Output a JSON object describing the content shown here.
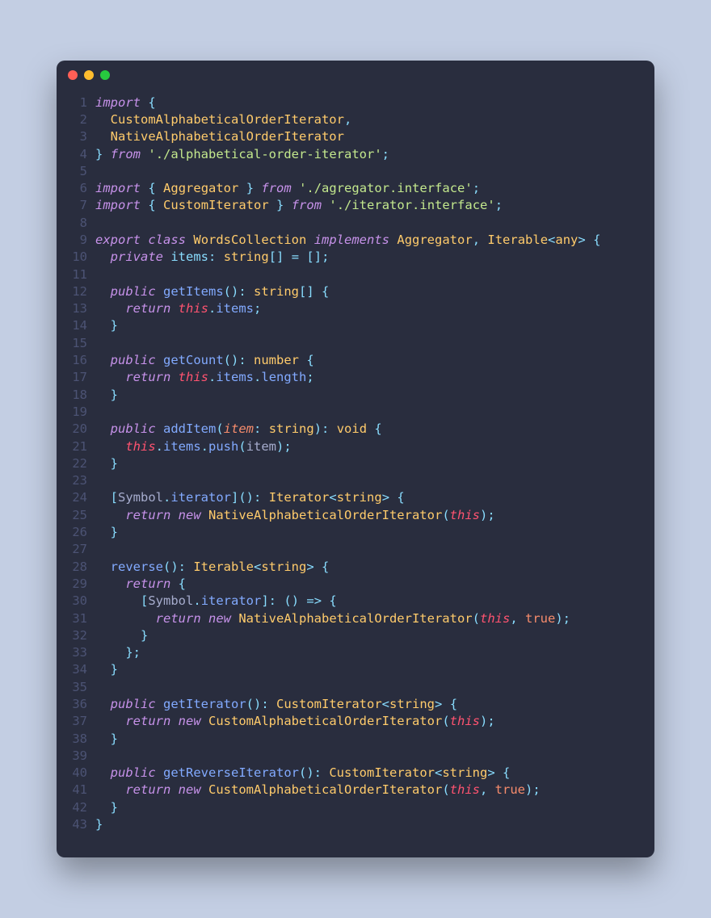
{
  "window": {
    "traffic_lights": [
      "close",
      "minimize",
      "zoom"
    ]
  },
  "code": {
    "language": "typescript",
    "lines": [
      [
        [
          "kw",
          "import"
        ],
        [
          "def",
          " "
        ],
        [
          "pun",
          "{"
        ]
      ],
      [
        [
          "def",
          "  "
        ],
        [
          "cls",
          "CustomAlphabeticalOrderIterator"
        ],
        [
          "pun",
          ","
        ]
      ],
      [
        [
          "def",
          "  "
        ],
        [
          "cls",
          "NativeAlphabeticalOrderIterator"
        ]
      ],
      [
        [
          "pun",
          "}"
        ],
        [
          "def",
          " "
        ],
        [
          "kw",
          "from"
        ],
        [
          "def",
          " "
        ],
        [
          "str",
          "'./alphabetical-order-iterator'"
        ],
        [
          "pun",
          ";"
        ]
      ],
      [],
      [
        [
          "kw",
          "import"
        ],
        [
          "def",
          " "
        ],
        [
          "pun",
          "{"
        ],
        [
          "def",
          " "
        ],
        [
          "cls",
          "Aggregator"
        ],
        [
          "def",
          " "
        ],
        [
          "pun",
          "}"
        ],
        [
          "def",
          " "
        ],
        [
          "kw",
          "from"
        ],
        [
          "def",
          " "
        ],
        [
          "str",
          "'./agregator.interface'"
        ],
        [
          "pun",
          ";"
        ]
      ],
      [
        [
          "kw",
          "import"
        ],
        [
          "def",
          " "
        ],
        [
          "pun",
          "{"
        ],
        [
          "def",
          " "
        ],
        [
          "cls",
          "CustomIterator"
        ],
        [
          "def",
          " "
        ],
        [
          "pun",
          "}"
        ],
        [
          "def",
          " "
        ],
        [
          "kw",
          "from"
        ],
        [
          "def",
          " "
        ],
        [
          "str",
          "'./iterator.interface'"
        ],
        [
          "pun",
          ";"
        ]
      ],
      [],
      [
        [
          "kw",
          "export"
        ],
        [
          "def",
          " "
        ],
        [
          "kw",
          "class"
        ],
        [
          "def",
          " "
        ],
        [
          "cls",
          "WordsCollection"
        ],
        [
          "def",
          " "
        ],
        [
          "kw",
          "implements"
        ],
        [
          "def",
          " "
        ],
        [
          "cls",
          "Aggregator"
        ],
        [
          "pun",
          ","
        ],
        [
          "def",
          " "
        ],
        [
          "cls",
          "Iterable"
        ],
        [
          "pun",
          "<"
        ],
        [
          "type",
          "any"
        ],
        [
          "pun",
          ">"
        ],
        [
          "def",
          " "
        ],
        [
          "pun",
          "{"
        ]
      ],
      [
        [
          "def",
          "  "
        ],
        [
          "mod",
          "private"
        ],
        [
          "def",
          " "
        ],
        [
          "var",
          "items"
        ],
        [
          "pun",
          ":"
        ],
        [
          "def",
          " "
        ],
        [
          "type",
          "string"
        ],
        [
          "pun",
          "[]"
        ],
        [
          "def",
          " "
        ],
        [
          "op",
          "="
        ],
        [
          "def",
          " "
        ],
        [
          "pun",
          "[];"
        ]
      ],
      [],
      [
        [
          "def",
          "  "
        ],
        [
          "mod",
          "public"
        ],
        [
          "def",
          " "
        ],
        [
          "fn",
          "getItems"
        ],
        [
          "pun",
          "():"
        ],
        [
          "def",
          " "
        ],
        [
          "type",
          "string"
        ],
        [
          "pun",
          "[]"
        ],
        [
          "def",
          " "
        ],
        [
          "pun",
          "{"
        ]
      ],
      [
        [
          "def",
          "    "
        ],
        [
          "kw",
          "return"
        ],
        [
          "def",
          " "
        ],
        [
          "this",
          "this"
        ],
        [
          "pun",
          "."
        ],
        [
          "prop",
          "items"
        ],
        [
          "pun",
          ";"
        ]
      ],
      [
        [
          "def",
          "  "
        ],
        [
          "pun",
          "}"
        ]
      ],
      [],
      [
        [
          "def",
          "  "
        ],
        [
          "mod",
          "public"
        ],
        [
          "def",
          " "
        ],
        [
          "fn",
          "getCount"
        ],
        [
          "pun",
          "():"
        ],
        [
          "def",
          " "
        ],
        [
          "type",
          "number"
        ],
        [
          "def",
          " "
        ],
        [
          "pun",
          "{"
        ]
      ],
      [
        [
          "def",
          "    "
        ],
        [
          "kw",
          "return"
        ],
        [
          "def",
          " "
        ],
        [
          "this",
          "this"
        ],
        [
          "pun",
          "."
        ],
        [
          "prop",
          "items"
        ],
        [
          "pun",
          "."
        ],
        [
          "prop",
          "length"
        ],
        [
          "pun",
          ";"
        ]
      ],
      [
        [
          "def",
          "  "
        ],
        [
          "pun",
          "}"
        ]
      ],
      [],
      [
        [
          "def",
          "  "
        ],
        [
          "mod",
          "public"
        ],
        [
          "def",
          " "
        ],
        [
          "fn",
          "addItem"
        ],
        [
          "pun",
          "("
        ],
        [
          "par",
          "item"
        ],
        [
          "pun",
          ":"
        ],
        [
          "def",
          " "
        ],
        [
          "type",
          "string"
        ],
        [
          "pun",
          "):"
        ],
        [
          "def",
          " "
        ],
        [
          "type",
          "void"
        ],
        [
          "def",
          " "
        ],
        [
          "pun",
          "{"
        ]
      ],
      [
        [
          "def",
          "    "
        ],
        [
          "this",
          "this"
        ],
        [
          "pun",
          "."
        ],
        [
          "prop",
          "items"
        ],
        [
          "pun",
          "."
        ],
        [
          "fn",
          "push"
        ],
        [
          "pun",
          "("
        ],
        [
          "def",
          "item"
        ],
        [
          "pun",
          ");"
        ]
      ],
      [
        [
          "def",
          "  "
        ],
        [
          "pun",
          "}"
        ]
      ],
      [],
      [
        [
          "def",
          "  "
        ],
        [
          "pun",
          "["
        ],
        [
          "def",
          "Symbol"
        ],
        [
          "pun",
          "."
        ],
        [
          "fn",
          "iterator"
        ],
        [
          "pun",
          "]():"
        ],
        [
          "def",
          " "
        ],
        [
          "cls",
          "Iterator"
        ],
        [
          "pun",
          "<"
        ],
        [
          "type",
          "string"
        ],
        [
          "pun",
          ">"
        ],
        [
          "def",
          " "
        ],
        [
          "pun",
          "{"
        ]
      ],
      [
        [
          "def",
          "    "
        ],
        [
          "kw",
          "return"
        ],
        [
          "def",
          " "
        ],
        [
          "kw",
          "new"
        ],
        [
          "def",
          " "
        ],
        [
          "cls",
          "NativeAlphabeticalOrderIterator"
        ],
        [
          "pun",
          "("
        ],
        [
          "this",
          "this"
        ],
        [
          "pun",
          ");"
        ]
      ],
      [
        [
          "def",
          "  "
        ],
        [
          "pun",
          "}"
        ]
      ],
      [],
      [
        [
          "def",
          "  "
        ],
        [
          "fn",
          "reverse"
        ],
        [
          "pun",
          "():"
        ],
        [
          "def",
          " "
        ],
        [
          "cls",
          "Iterable"
        ],
        [
          "pun",
          "<"
        ],
        [
          "type",
          "string"
        ],
        [
          "pun",
          ">"
        ],
        [
          "def",
          " "
        ],
        [
          "pun",
          "{"
        ]
      ],
      [
        [
          "def",
          "    "
        ],
        [
          "kw",
          "return"
        ],
        [
          "def",
          " "
        ],
        [
          "pun",
          "{"
        ]
      ],
      [
        [
          "def",
          "      "
        ],
        [
          "pun",
          "["
        ],
        [
          "def",
          "Symbol"
        ],
        [
          "pun",
          "."
        ],
        [
          "fn",
          "iterator"
        ],
        [
          "pun",
          "]:"
        ],
        [
          "def",
          " "
        ],
        [
          "pun",
          "()"
        ],
        [
          "def",
          " "
        ],
        [
          "op",
          "=>"
        ],
        [
          "def",
          " "
        ],
        [
          "pun",
          "{"
        ]
      ],
      [
        [
          "def",
          "        "
        ],
        [
          "kw",
          "return"
        ],
        [
          "def",
          " "
        ],
        [
          "kw",
          "new"
        ],
        [
          "def",
          " "
        ],
        [
          "cls",
          "NativeAlphabeticalOrderIterator"
        ],
        [
          "pun",
          "("
        ],
        [
          "this",
          "this"
        ],
        [
          "pun",
          ","
        ],
        [
          "def",
          " "
        ],
        [
          "num",
          "true"
        ],
        [
          "pun",
          ");"
        ]
      ],
      [
        [
          "def",
          "      "
        ],
        [
          "pun",
          "}"
        ]
      ],
      [
        [
          "def",
          "    "
        ],
        [
          "pun",
          "};"
        ]
      ],
      [
        [
          "def",
          "  "
        ],
        [
          "pun",
          "}"
        ]
      ],
      [],
      [
        [
          "def",
          "  "
        ],
        [
          "mod",
          "public"
        ],
        [
          "def",
          " "
        ],
        [
          "fn",
          "getIterator"
        ],
        [
          "pun",
          "():"
        ],
        [
          "def",
          " "
        ],
        [
          "cls",
          "CustomIterator"
        ],
        [
          "pun",
          "<"
        ],
        [
          "type",
          "string"
        ],
        [
          "pun",
          ">"
        ],
        [
          "def",
          " "
        ],
        [
          "pun",
          "{"
        ]
      ],
      [
        [
          "def",
          "    "
        ],
        [
          "kw",
          "return"
        ],
        [
          "def",
          " "
        ],
        [
          "kw",
          "new"
        ],
        [
          "def",
          " "
        ],
        [
          "cls",
          "CustomAlphabeticalOrderIterator"
        ],
        [
          "pun",
          "("
        ],
        [
          "this",
          "this"
        ],
        [
          "pun",
          ");"
        ]
      ],
      [
        [
          "def",
          "  "
        ],
        [
          "pun",
          "}"
        ]
      ],
      [],
      [
        [
          "def",
          "  "
        ],
        [
          "mod",
          "public"
        ],
        [
          "def",
          " "
        ],
        [
          "fn",
          "getReverseIterator"
        ],
        [
          "pun",
          "():"
        ],
        [
          "def",
          " "
        ],
        [
          "cls",
          "CustomIterator"
        ],
        [
          "pun",
          "<"
        ],
        [
          "type",
          "string"
        ],
        [
          "pun",
          ">"
        ],
        [
          "def",
          " "
        ],
        [
          "pun",
          "{"
        ]
      ],
      [
        [
          "def",
          "    "
        ],
        [
          "kw",
          "return"
        ],
        [
          "def",
          " "
        ],
        [
          "kw",
          "new"
        ],
        [
          "def",
          " "
        ],
        [
          "cls",
          "CustomAlphabeticalOrderIterator"
        ],
        [
          "pun",
          "("
        ],
        [
          "this",
          "this"
        ],
        [
          "pun",
          ","
        ],
        [
          "def",
          " "
        ],
        [
          "num",
          "true"
        ],
        [
          "pun",
          ");"
        ]
      ],
      [
        [
          "def",
          "  "
        ],
        [
          "pun",
          "}"
        ]
      ],
      [
        [
          "pun",
          "}"
        ]
      ]
    ]
  }
}
